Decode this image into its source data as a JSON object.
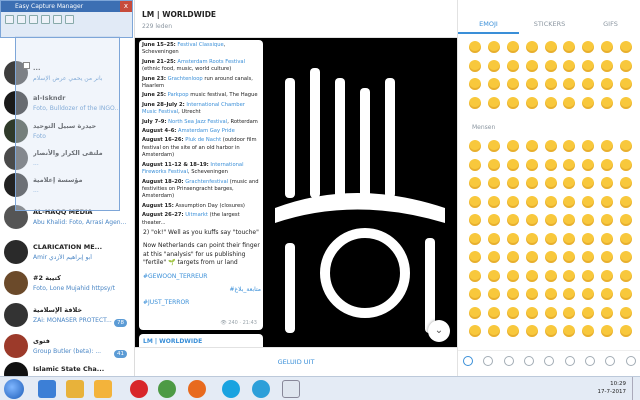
{
  "capture_manager": {
    "title": "Easy Capture Manager",
    "close_label": "x"
  },
  "sidebar": {
    "items": [
      {
        "name": "...",
        "preview": "بانر من يحمي عرض الإسلام",
        "avatar_color": "#3d3d3d"
      },
      {
        "name": "al-Iskndr",
        "preview": "Foto, Bulldozer of the INGO...",
        "avatar_color": "#1a1a1a"
      },
      {
        "name": "حيدرة سبيل التوحيد",
        "preview": "Foto",
        "avatar_color": "#2f3a2a"
      },
      {
        "name": "ملتقى الكرار والأنصار",
        "preview": "...",
        "avatar_color": "#4a4a4a"
      },
      {
        "name": "مؤسسة إعلامية",
        "preview": "...",
        "avatar_color": "#222"
      },
      {
        "name": "AL-HAQQ MEDIA",
        "preview": "Abu Khalid: Foto, Arrasi Agen...",
        "avatar_color": "#555"
      },
      {
        "name": "CLARICATION ME...",
        "preview": "Amir أبو إبراهيم الأزدي",
        "avatar_color": "#2a2a2a"
      },
      {
        "name": "#2 كتيبة",
        "preview": "Foto, Lone Mujahid httpsy/t",
        "avatar_color": "#6b4a2a"
      },
      {
        "name": "خلافة الإسلامية",
        "preview": "ZAi: MONASER PROTECT...",
        "avatar_color": "#333",
        "badge": "78"
      },
      {
        "name": "فتوى",
        "preview": "Group Butler (beta): ...",
        "avatar_color": "#9c3a2a",
        "badge": "41"
      },
      {
        "name": "Islamic State Cha...",
        "preview": "...",
        "avatar_color": "#111"
      }
    ]
  },
  "chat": {
    "title": "LM | WORLDWIDE",
    "members": "229 leden",
    "events": [
      {
        "date": "June 15–25:",
        "link": "Festival Classique",
        "rest": ", Scheveningen"
      },
      {
        "date": "June 21–25:",
        "link": "Amsterdam Roots Festival",
        "rest": " (ethnic food, music, world culture)"
      },
      {
        "date": "June 23:",
        "link": "Grachtenloop",
        "rest": " run around canals, Haarlem"
      },
      {
        "date": "June 25:",
        "link": "Parkpop",
        "rest": " music festival, The Hague"
      },
      {
        "date": "June 28–July 2:",
        "link": "International Chamber Music Festival",
        "rest": ", Utrecht"
      },
      {
        "date": "July 7–9:",
        "link": "North Sea Jazz Festival",
        "rest": ", Rotterdam"
      },
      {
        "date": "August 4–6:",
        "link": "Amsterdam Gay Pride",
        "rest": ""
      },
      {
        "date": "August 16–26:",
        "link": "Pluk de Nacht",
        "rest": " (outdoor film festival on the site of an old harbor in Amsterdam)"
      },
      {
        "date": "August 11–12 & 18–19:",
        "link": "International Fireworks Festival",
        "rest": ", Scheveningen"
      },
      {
        "date": "August 18–20:",
        "link": "Grachtenfestival",
        "rest": " (music and festivities on Prinsengracht barges, Amsterdam)"
      },
      {
        "date": "August 15:",
        "link": "",
        "rest": " Assumption Day (closures)"
      },
      {
        "date": "August 26–27:",
        "link": "Uitmarkt",
        "rest": " (the largest theater..."
      }
    ],
    "body": [
      "2) \"ok!\" Well as you kuffs say \"touche\"",
      "Now Netherlands can point their finger at this \"analysis\" for us publishing \"fertile\" 🌱 targets from ur land"
    ],
    "hashtags": [
      "#GEWOON_TERREUR",
      "#متابعة_بلاغ",
      "#JUST_TERROR"
    ],
    "meta": "👁 240 · 21:43",
    "forward_title": "LM | WORLDWIDE",
    "mute_label": "GELUID UIT",
    "flag_text": "لا إله إلا الله محمد رسول الله"
  },
  "emoji_panel": {
    "tabs": [
      "EMOJI",
      "STICKERS",
      "GIFS"
    ],
    "section_label": "Mensen"
  },
  "taskbar": {
    "time": "10:29",
    "date": "17-7-2017"
  }
}
